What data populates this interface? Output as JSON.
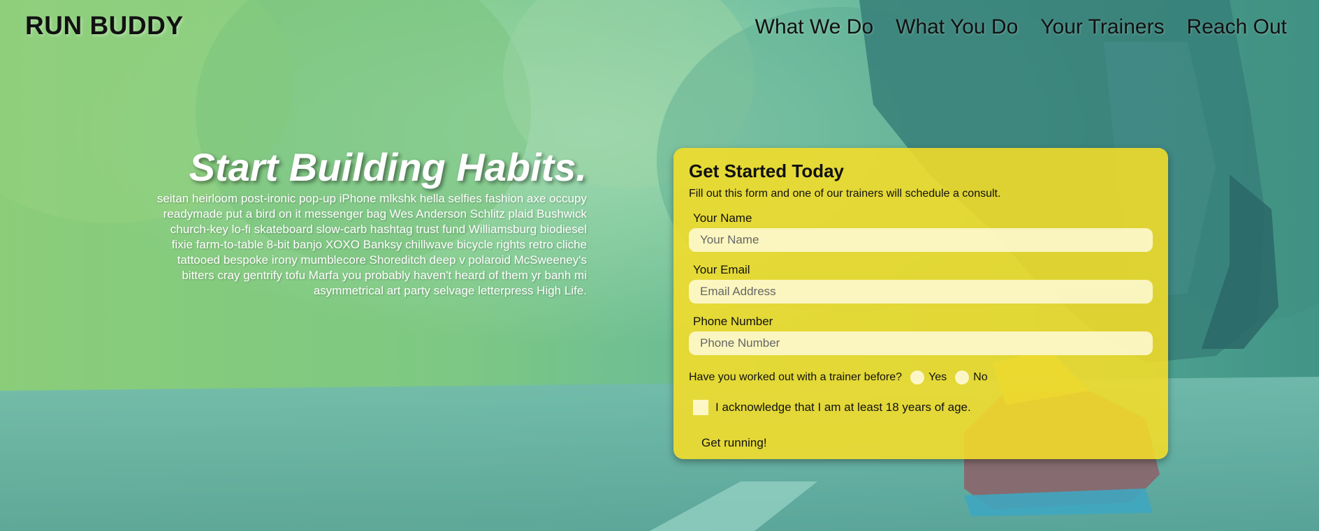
{
  "header": {
    "logo": "RUN BUDDY",
    "nav": [
      "What We Do",
      "What You Do",
      "Your Trainers",
      "Reach Out"
    ]
  },
  "intro": {
    "heading": "Start Building Habits.",
    "body": "seitan heirloom post-ironic pop-up iPhone mlkshk hella selfies fashion axe occupy readymade put a bird on it messenger bag Wes Anderson Schlitz plaid Bushwick church-key lo-fi skateboard slow-carb hashtag trust fund Williamsburg biodiesel fixie farm-to-table 8-bit banjo XOXO Banksy chillwave bicycle rights retro cliche tattooed bespoke irony mumblecore Shoreditch deep v polaroid McSweeney's bitters cray gentrify tofu Marfa you probably haven't heard of them yr banh mi asymmetrical art party selvage letterpress High Life."
  },
  "form": {
    "title": "Get Started Today",
    "subtitle": "Fill out this form and one of our trainers will schedule a consult.",
    "name_label": "Your Name",
    "name_placeholder": "Your Name",
    "email_label": "Your Email",
    "email_placeholder": "Email Address",
    "phone_label": "Phone Number",
    "phone_placeholder": "Phone Number",
    "trainer_question": "Have you worked out with a trainer before?",
    "yes_label": "Yes",
    "no_label": "No",
    "acknowledge_label": "I acknowledge that I am at least 18 years of age.",
    "submit_label": "Get running!"
  },
  "colors": {
    "overlay": "#6fb7a8",
    "form_background": "#f5dd28",
    "input_background": "#fffad7",
    "heading_text": "#ffffff",
    "nav_text": "#111111"
  },
  "icons": [
    "hero-photo"
  ]
}
